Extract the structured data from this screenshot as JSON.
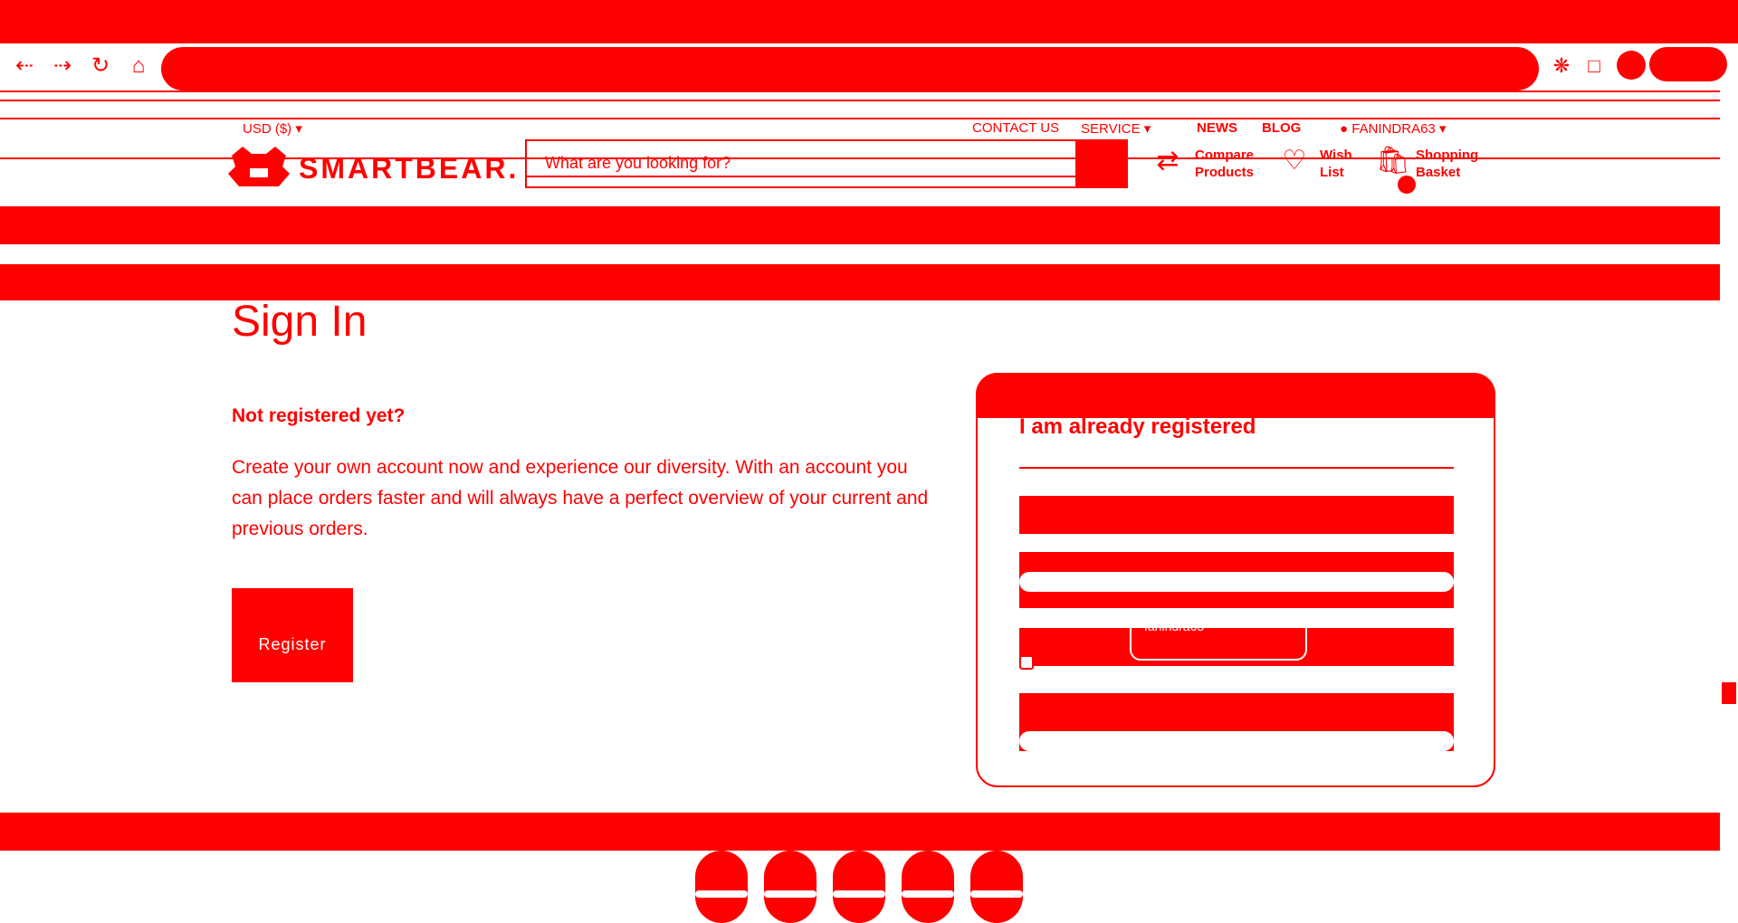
{
  "browser": {
    "back_icon": "arrow-left-icon",
    "forward_icon": "arrow-right-icon",
    "reload_icon": "reload-icon",
    "home_icon": "home-icon"
  },
  "topbar": {
    "currency": "USD  ($)",
    "contact": "CONTACT US",
    "service": "SERVICE",
    "news": "NEWS",
    "blog": "BLOG",
    "user": "FANINDRA63"
  },
  "header": {
    "logo": "SMARTBEAR.",
    "search_placeholder": "What are you looking for?",
    "compare": "Compare Products",
    "compare_l1": "Compare",
    "compare_l2": "Products",
    "wish_l1": "Wish",
    "wish_l2": "List",
    "basket_l1": "Shopping",
    "basket_l2": "Basket"
  },
  "main": {
    "title": "Sign In",
    "not_registered": "Not registered yet?",
    "description": "Create your own account now and experience our diversity. With an account you can place orders faster and will always have a perfect overview of your current and previous orders.",
    "register_label": "Register"
  },
  "login": {
    "heading": "I am already registered",
    "username_value": "fanindra63"
  },
  "colors": {
    "accent": "#ff0000",
    "background": "#ffffff"
  }
}
